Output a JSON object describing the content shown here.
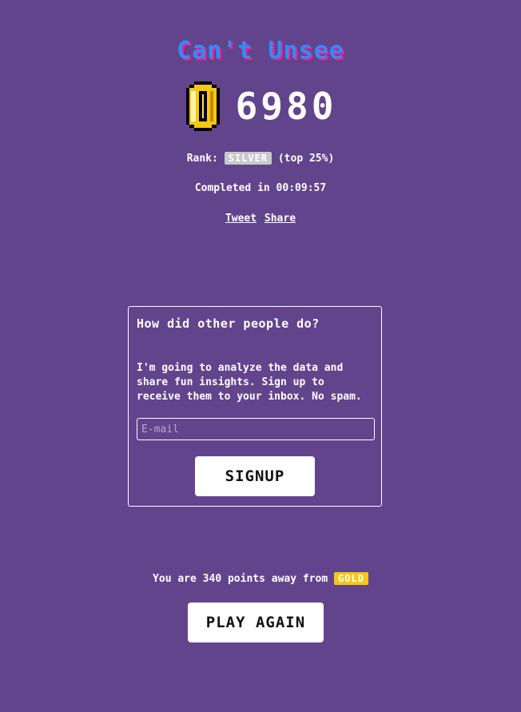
{
  "title": "Can't Unsee",
  "score": "6980",
  "icons": {
    "coin": "coin-icon"
  },
  "colors": {
    "background": "#62448d",
    "title": "#2f8cff",
    "title_shadow": "#ff1a8c",
    "silver": "#c9c9c9",
    "gold": "#f7c713"
  },
  "rank": {
    "label": "Rank:",
    "badge": "SILVER",
    "suffix": "(top 25%)"
  },
  "completed_text": "Completed in 00:09:57",
  "links": {
    "tweet": "Tweet",
    "share": "Share"
  },
  "signup_card": {
    "heading": "How did other people do?",
    "body": "I'm going to analyze the data and share fun insights. Sign up to receive them to your inbox. No spam.",
    "email_placeholder": "E-mail",
    "email_value": "",
    "button_label": "SIGNUP"
  },
  "next_rank": {
    "prefix": "You are",
    "points": "340",
    "middle": "points away from",
    "badge": "GOLD"
  },
  "play_again_label": "PLAY AGAIN"
}
